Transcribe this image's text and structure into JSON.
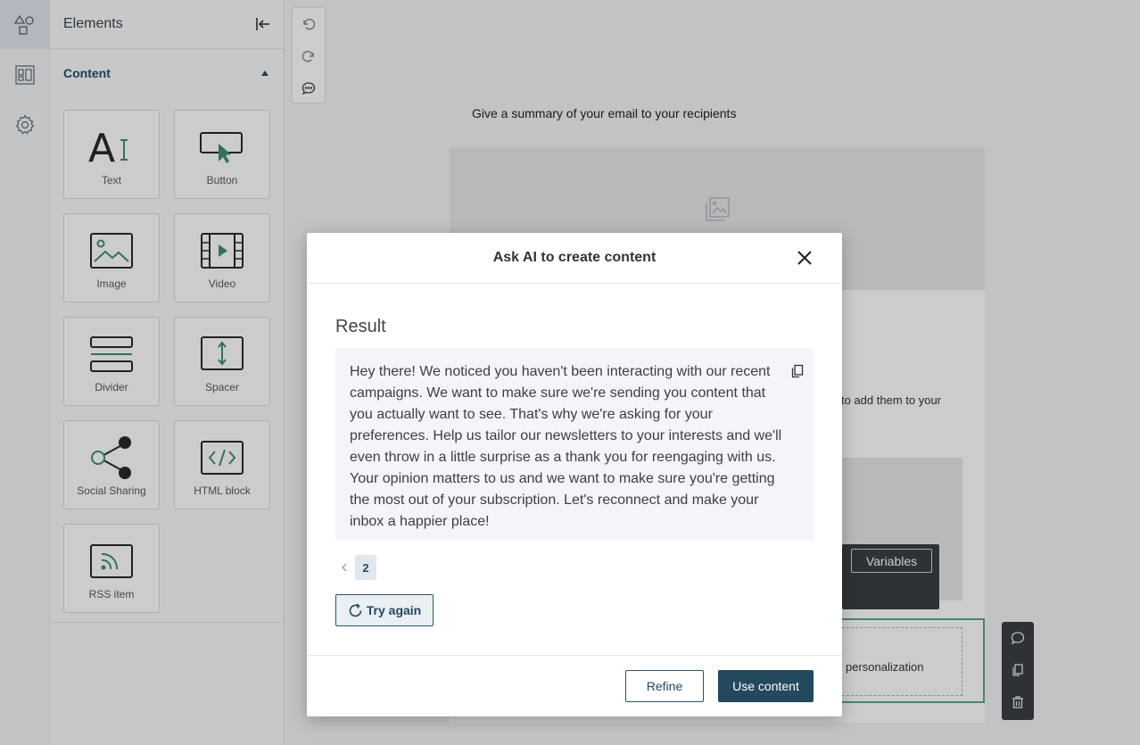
{
  "sidebar": {
    "title": "Elements",
    "section_title": "Content",
    "tiles": [
      {
        "label": "Text",
        "icon": "text-icon"
      },
      {
        "label": "Button",
        "icon": "button-icon"
      },
      {
        "label": "Image",
        "icon": "image-icon"
      },
      {
        "label": "Video",
        "icon": "video-icon"
      },
      {
        "label": "Divider",
        "icon": "divider-icon"
      },
      {
        "label": "Spacer",
        "icon": "spacer-icon"
      },
      {
        "label": "Social Sharing",
        "icon": "social-sharing-icon"
      },
      {
        "label": "HTML block",
        "icon": "html-block-icon"
      },
      {
        "label": "RSS item",
        "icon": "rss-icon"
      }
    ]
  },
  "canvas": {
    "summary_text": "Give a summary of your email to your recipients",
    "partial_text": "to add them to your",
    "variables_label": "Variables",
    "personalization_text": "personalization"
  },
  "modal": {
    "title": "Ask AI to create content",
    "result_heading": "Result",
    "result_text": "Hey there! We noticed you haven't been interacting with our recent campaigns. We want to make sure we're sending you content that you actually want to see. That's why we're asking for your preferences. Help us tailor our newsletters to your interests and we'll even throw in a little surprise as a thank you for reengaging with us. Your opinion matters to us and we want to make sure you're getting the most out of your subscription. Let's reconnect and make your inbox a happier place!",
    "current_page": "2",
    "try_again_label": "Try again",
    "refine_label": "Refine",
    "use_content_label": "Use content"
  },
  "colors": {
    "accent": "#24485c",
    "icon_green": "#3f8f73",
    "section_blue": "#1f4e68"
  }
}
